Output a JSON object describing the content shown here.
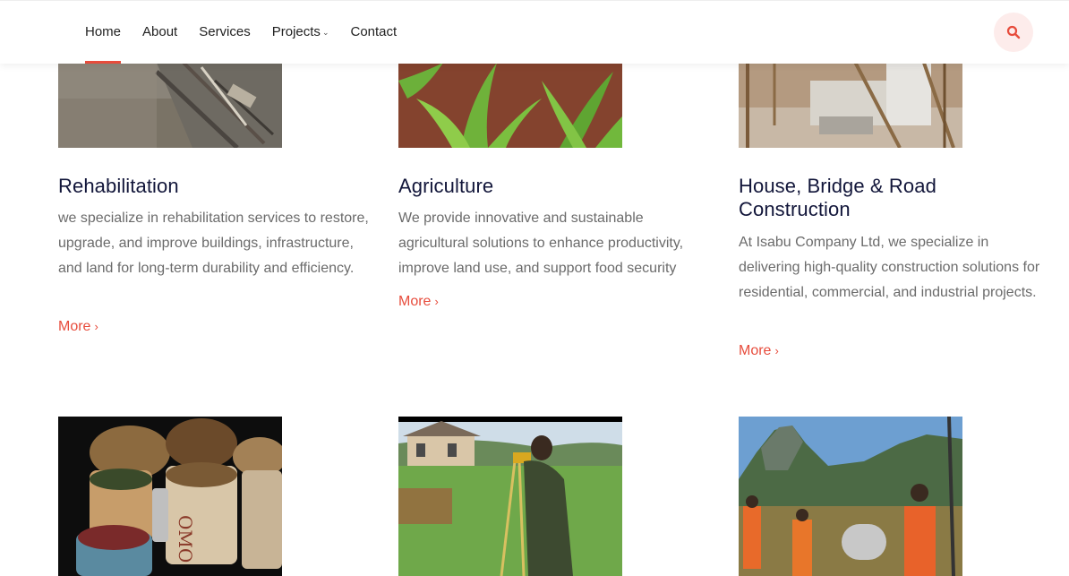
{
  "nav": {
    "items": [
      {
        "label": "Home",
        "active": true
      },
      {
        "label": "About"
      },
      {
        "label": "Services"
      },
      {
        "label": "Projects",
        "has_dropdown": true
      },
      {
        "label": "Contact"
      }
    ],
    "search_icon": "search-icon"
  },
  "cards": [
    {
      "title": "Rehabilitation",
      "text": "we specialize in rehabilitation services to restore, upgrade, and improve buildings, infrastructure, and land for long-term durability and efficiency.",
      "more": "More",
      "image": "demolition-rubble-photo"
    },
    {
      "title": "Agriculture",
      "text": "We provide innovative and sustainable agricultural solutions to enhance productivity, improve land use, and support food security",
      "more": "More",
      "image": "maize-seedlings-photo"
    },
    {
      "title": "House, Bridge & Road Construction",
      "text": "At Isabu Company Ltd, we specialize in delivering high-quality construction solutions for residential, commercial, and industrial projects.",
      "more": "More",
      "image": "construction-scaffolding-photo"
    }
  ],
  "bottom_images": [
    "grain-sacks-photo",
    "surveyor-photo",
    "field-workers-mountain-photo"
  ],
  "colors": {
    "accent": "#e74c3c",
    "title": "#12163a",
    "body_text": "#6b6b6b"
  }
}
